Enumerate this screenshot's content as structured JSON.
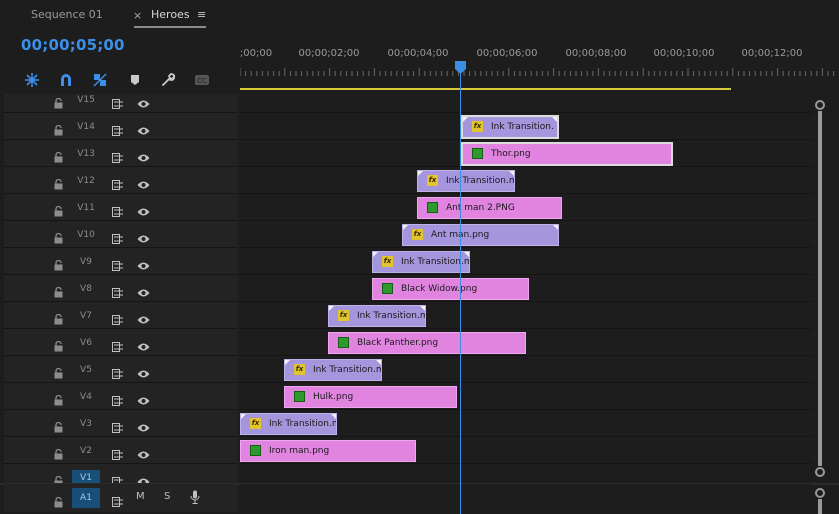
{
  "tabs": [
    {
      "label": "Sequence 01",
      "active": false
    },
    {
      "label": "Heroes",
      "active": true
    }
  ],
  "tab_close": "×",
  "tab_menu": "≡",
  "timecode": "00;00;05;00",
  "toolbar": {
    "icons": [
      "snap-insert-icon",
      "magnet-snap-icon",
      "linked-selection-icon",
      "marker-icon",
      "wrench-icon",
      "captions-icon"
    ]
  },
  "ruler": {
    "labels": [
      ";00;00",
      "00;00;02;00",
      "00;00;04;00",
      "00;00;06;00",
      "00;00;08;00",
      "00;00;10;00",
      "00;00;12;00"
    ]
  },
  "tracks": [
    {
      "name": "V15"
    },
    {
      "name": "V14"
    },
    {
      "name": "V13"
    },
    {
      "name": "V12"
    },
    {
      "name": "V11"
    },
    {
      "name": "V10"
    },
    {
      "name": "V9"
    },
    {
      "name": "V8"
    },
    {
      "name": "V7"
    },
    {
      "name": "V6"
    },
    {
      "name": "V5"
    },
    {
      "name": "V4"
    },
    {
      "name": "V3"
    },
    {
      "name": "V2"
    },
    {
      "name": "V1",
      "selected": true
    }
  ],
  "audio_track": {
    "name": "A1",
    "mute": "M",
    "solo": "S"
  },
  "clips": [
    {
      "label": "Ink Transition.",
      "kind": "fx",
      "track": "V14"
    },
    {
      "label": "Thor.png",
      "kind": "img",
      "track": "V13"
    },
    {
      "label": "Ink Transition.m",
      "kind": "fx",
      "track": "V12"
    },
    {
      "label": "Ant man 2.PNG",
      "kind": "img",
      "track": "V11"
    },
    {
      "label": "Ant man.png",
      "kind": "fx",
      "track": "V10"
    },
    {
      "label": "Ink Transition.m",
      "kind": "fx",
      "track": "V9"
    },
    {
      "label": "Black Widow.png",
      "kind": "img",
      "track": "V8"
    },
    {
      "label": "Ink Transition.m",
      "kind": "fx",
      "track": "V7"
    },
    {
      "label": "Black Panther.png",
      "kind": "img",
      "track": "V6"
    },
    {
      "label": "Ink Transition.m",
      "kind": "fx",
      "track": "V5"
    },
    {
      "label": "Hulk.png",
      "kind": "img",
      "track": "V4"
    },
    {
      "label": "Ink Transition.m",
      "kind": "fx",
      "track": "V3"
    },
    {
      "label": "Iron man.png",
      "kind": "img",
      "track": "V2"
    }
  ],
  "badge_fx_text": "fx",
  "colors": {
    "accent_blue": "#3b8fe8",
    "fx_clip": "#a595dc",
    "image_clip": "#e184e0",
    "work_area": "#d6c93a",
    "selected_track": "#174f78"
  }
}
